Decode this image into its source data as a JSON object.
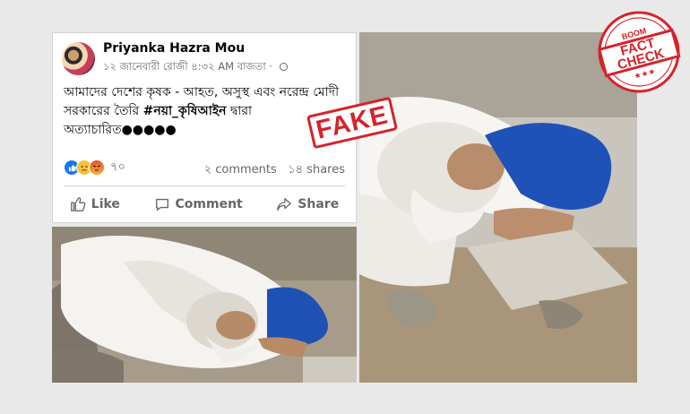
{
  "post": {
    "author": "Priyanka Hazra Mou",
    "meta": "১২ জানেবারী রোজী ৪:৩২ AM বাজতা ·",
    "text_main": "আমাদের দেশের কৃষক - আহত, অসুস্থ এবং নরেন্দ্র মোদী সরকারের তৈরি ",
    "hashtag": "#নয়া_কৃষিআইন",
    "text_tail": " দ্বারা অত্যাচারিত●●●●●",
    "reaction_count": "৭০",
    "comments": "২ comments",
    "shares": "১৪ shares",
    "actions": {
      "like": "Like",
      "comment": "Comment",
      "share": "Share"
    },
    "reaction_icons": [
      "like-reaction",
      "sad-reaction",
      "angry-reaction"
    ]
  },
  "stamp": {
    "label": "FAKE",
    "color": "#d5232a"
  },
  "badge": {
    "top": "BOOM",
    "line1": "FACT",
    "line2": "CHECK",
    "stars": "★★★",
    "color": "#d5232a"
  },
  "colors": {
    "link_blue": "#1877f2",
    "muted": "#65676b",
    "background": "#e9e9ea"
  }
}
